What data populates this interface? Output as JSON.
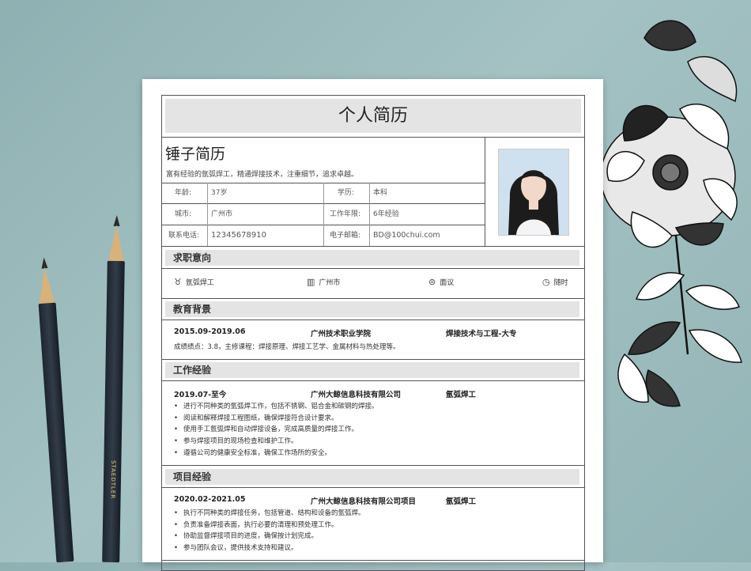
{
  "resume": {
    "title": "个人简历",
    "name": "锤子简历",
    "slogan": "富有经验的氩弧焊工，精通焊接技术，注重细节，追求卓越。",
    "info": [
      {
        "label": "年龄:",
        "value": "37岁"
      },
      {
        "label": "学历:",
        "value": "本科"
      },
      {
        "label": "城市:",
        "value": "广州市"
      },
      {
        "label": "工作年限:",
        "value": "6年经验"
      },
      {
        "label": "联系电话:",
        "value": "12345678910"
      },
      {
        "label": "电子邮箱:",
        "value": "BD@100chui.com"
      }
    ],
    "sections": {
      "intent": "求职意向",
      "education": "教育背景",
      "work": "工作经验",
      "project": "项目经验"
    },
    "intent": {
      "job": "氩弧焊工",
      "city": "广州市",
      "salary": "面议",
      "start": "随时"
    },
    "education": {
      "period": "2015.09-2019.06",
      "school": "广州技术职业学院",
      "major": "焊接技术与工程-大专",
      "desc": "成绩绩点：3.8，主修课程：焊接原理、焊接工艺学、金属材料与热处理等。"
    },
    "work": {
      "period": "2019.07-至今",
      "company": "广州大鲸信息科技有限公司",
      "role": "氩弧焊工",
      "bullets": [
        "进行不同种类的氩弧焊工作，包括不锈钢、铝合金和碳钢的焊接。",
        "阅读和解释焊接工程图纸，确保焊接符合设计要求。",
        "使用手工氩弧焊和自动焊接设备，完成高质量的焊接工作。",
        "参与焊接项目的现场检查和维护工作。",
        "遵循公司的健康安全标准，确保工作场所的安全。"
      ]
    },
    "project": {
      "period": "2020.02-2021.05",
      "company": "广州大鲸信息科技有限公司项目",
      "role": "氩弧焊工",
      "bullets": [
        "执行不同种类的焊接任务，包括管道、结构和设备的氩弧焊。",
        "负责准备焊接表面，执行必要的清理和预处理工作。",
        "协助监督焊接项目的进度，确保按计划完成。",
        "参与团队会议，提供技术支持和建议。"
      ]
    },
    "icons": {
      "job": "tie-icon",
      "city": "building-icon",
      "salary": "yen-icon",
      "start": "clock-icon"
    }
  },
  "decor": {
    "pencil_brand": "STAEDTLER"
  }
}
